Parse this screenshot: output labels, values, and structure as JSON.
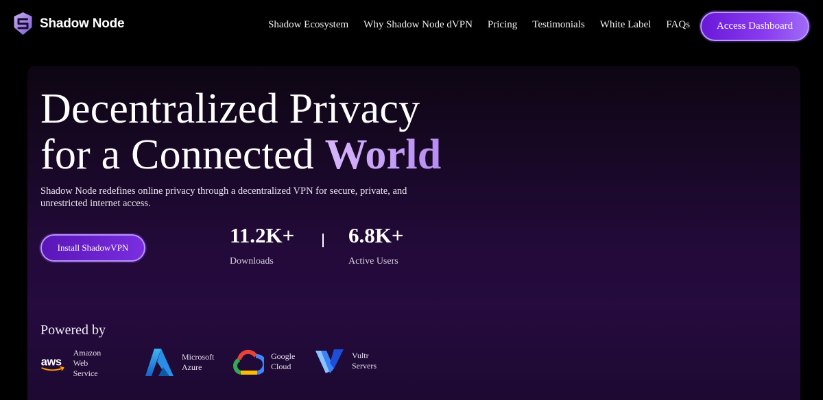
{
  "brand": {
    "name": "Shadow Node"
  },
  "nav": {
    "links": [
      "Shadow Ecosystem",
      "Why Shadow Node dVPN",
      "Pricing",
      "Testimonials",
      "White Label",
      "FAQs"
    ],
    "cta_label": "Access Dashboard"
  },
  "hero": {
    "headline_line1": "Decentralized Privacy",
    "headline_line2_prefix": "for a Connected ",
    "headline_accent": "World",
    "subtext": "Shadow Node redefines online privacy through a decentralized VPN for secure, private, and unrestricted internet access.",
    "cta_label": "Install ShadowVPN",
    "stats": [
      {
        "value": "11.2K+",
        "label": "Downloads"
      },
      {
        "value": "6.8K+",
        "label": "Active Users"
      }
    ]
  },
  "powered": {
    "title": "Powered by",
    "providers": [
      {
        "icon": "aws-icon",
        "name_line1": "Amazon Web",
        "name_line2": "Service"
      },
      {
        "icon": "azure-icon",
        "name_line1": "Microsoft",
        "name_line2": "Azure"
      },
      {
        "icon": "google-cloud-icon",
        "name_line1": "Google",
        "name_line2": "Cloud"
      },
      {
        "icon": "vultr-icon",
        "name_line1": "Vultr",
        "name_line2": "Servers"
      }
    ]
  },
  "colors": {
    "background": "#000000",
    "accent": "#7a2ee0",
    "accent_light": "#b896f5",
    "headline_accent": "#c9a2f8"
  }
}
